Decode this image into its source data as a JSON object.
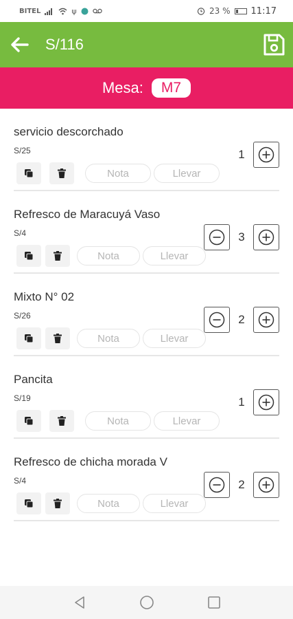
{
  "status_bar": {
    "carrier": "BITEL",
    "battery": "23 %",
    "battery_level": 0.23,
    "time": "11:17",
    "icons": [
      "signal-icon",
      "wifi-icon",
      "usb-icon",
      "app-dot-icon",
      "voicemail-icon",
      "alarm-icon",
      "battery-icon"
    ]
  },
  "header": {
    "title": "S/116",
    "back_icon": "arrow-left-icon",
    "save_icon": "save-icon"
  },
  "table": {
    "label": "Mesa:",
    "value": "M7"
  },
  "colors": {
    "app_bar": "#77bb3f",
    "table_bar": "#e91e63"
  },
  "items": [
    {
      "name": "servicio descorchado",
      "price": "S/25",
      "quantity": "1",
      "note_label": "Nota",
      "takeaway_label": "Llevar",
      "show_minus": false
    },
    {
      "name": "Refresco de Maracuyá Vaso",
      "price": "S/4",
      "quantity": "3",
      "note_label": "Nota",
      "takeaway_label": "Llevar",
      "show_minus": true
    },
    {
      "name": "Mixto N° 02",
      "price": "S/26",
      "quantity": "2",
      "note_label": "Nota",
      "takeaway_label": "Llevar",
      "show_minus": true
    },
    {
      "name": "Pancita",
      "price": "S/19",
      "quantity": "1",
      "note_label": "Nota",
      "takeaway_label": "Llevar",
      "show_minus": false
    },
    {
      "name": "Refresco de chicha morada V",
      "price": "S/4",
      "quantity": "2",
      "note_label": "Nota",
      "takeaway_label": "Llevar",
      "show_minus": true
    }
  ]
}
